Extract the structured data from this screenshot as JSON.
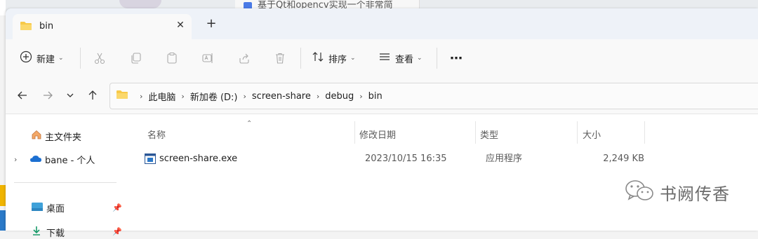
{
  "background": {
    "tab_text": "基于Qt和opencv实现一个非常简"
  },
  "tab": {
    "title": "bin",
    "close_glyph": "✕",
    "new_tab_glyph": "+"
  },
  "toolbar": {
    "new_label": "新建",
    "sort_label": "排序",
    "view_label": "查看",
    "more_glyph": "⋯",
    "icons": [
      "new-icon",
      "cut-icon",
      "copy-icon",
      "paste-icon",
      "rename-icon",
      "share-icon",
      "delete-icon",
      "sort-icon",
      "view-icon",
      "more-icon"
    ]
  },
  "address": {
    "crumbs": [
      "此电脑",
      "新加卷 (D:)",
      "screen-share",
      "debug",
      "bin"
    ]
  },
  "navpane": {
    "home": "主文件夹",
    "onedrive": "bane - 个人",
    "desktop": "桌面",
    "downloads": "下载"
  },
  "columns": {
    "name": "名称",
    "modified": "修改日期",
    "type": "类型",
    "size": "大小"
  },
  "files": [
    {
      "name": "screen-share.exe",
      "modified": "2023/10/15 16:35",
      "type": "应用程序",
      "size": "2,249 KB"
    }
  ],
  "watermark": {
    "text": "书阙传香"
  },
  "colors": {
    "accent": "#0067c0",
    "folder": "#f7c948",
    "window_bg": "#eef2f8",
    "toolbar_bg": "#f9f9f9"
  }
}
